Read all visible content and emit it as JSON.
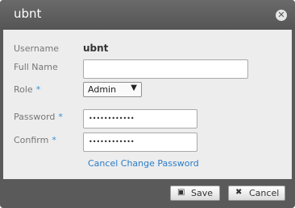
{
  "dialog": {
    "title": "ubnt",
    "close_icon": "close-icon"
  },
  "form": {
    "username_label": "Username",
    "username_value": "ubnt",
    "fullname_label": "Full Name",
    "fullname_value": "",
    "role_label": "Role",
    "role_required": "*",
    "role_value": "Admin",
    "password_label": "Password",
    "password_required": "*",
    "password_value": "••••••••••••",
    "confirm_label": "Confirm",
    "confirm_required": "*",
    "confirm_value": "••••••••••••",
    "cancel_change_link": "Cancel Change Password"
  },
  "footer": {
    "save_label": "Save",
    "save_icon": "floppy-disk-icon",
    "cancel_label": "Cancel",
    "cancel_icon": "x-icon"
  }
}
